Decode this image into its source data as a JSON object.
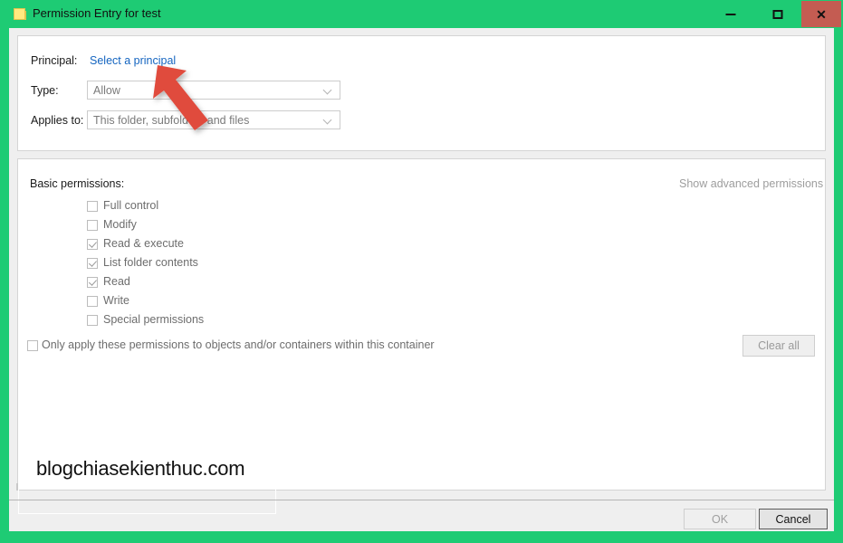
{
  "window": {
    "title": "Permission Entry for test",
    "icon": "folder-icon",
    "frame_color": "#1ecb74",
    "close_button_color": "#c45c52",
    "caption": {
      "minimize_label": "–",
      "maximize_label": "□",
      "close_label": "✕"
    }
  },
  "principal_section": {
    "principal_label": "Principal:",
    "principal_link": "Select a principal",
    "type_label": "Type:",
    "type_value": "Allow",
    "applies_to_label": "Applies to:",
    "applies_to_value": "This folder, subfolders and files"
  },
  "permissions_section": {
    "heading": "Basic permissions:",
    "advanced_link": "Show advanced permissions",
    "items": [
      {
        "label": "Full control",
        "checked": false
      },
      {
        "label": "Modify",
        "checked": false
      },
      {
        "label": "Read & execute",
        "checked": true
      },
      {
        "label": "List folder contents",
        "checked": true
      },
      {
        "label": "Read",
        "checked": true
      },
      {
        "label": "Write",
        "checked": false
      },
      {
        "label": "Special permissions",
        "checked": false
      }
    ],
    "only_apply": {
      "label": "Only apply these permissions to objects and/or containers within this container",
      "checked": false
    },
    "clear_all_label": "Clear all"
  },
  "footer": {
    "ok_label": "OK",
    "cancel_label": "Cancel"
  },
  "watermark": "blogchiasekienthuc.com",
  "annotation": {
    "type": "arrow-pointer",
    "color": "#e04b3c",
    "points_to": "Select a principal"
  }
}
